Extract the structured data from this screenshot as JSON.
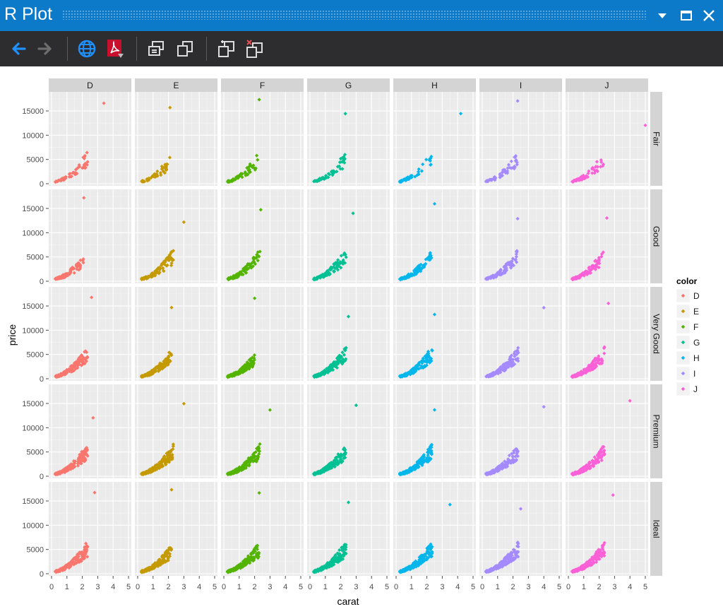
{
  "window": {
    "title": "R Plot",
    "controls": [
      "dropdown-icon",
      "maximize-icon",
      "close-icon"
    ],
    "titlebar_color": "#0c7ac9"
  },
  "toolbar": {
    "buttons": [
      "back-arrow-icon",
      "forward-arrow-icon",
      "globe-icon",
      "pdf-icon",
      "export-icon",
      "copy-icon",
      "copy-plot-icon",
      "remove-plot-icon"
    ],
    "background": "#2d2d30"
  },
  "chart_data": {
    "type": "scatter",
    "xlabel": "carat",
    "ylabel": "price",
    "xlim": [
      0,
      5
    ],
    "ylim": [
      0,
      18500
    ],
    "xticks": [
      0,
      1,
      2,
      3,
      4,
      5
    ],
    "yticks": [
      0,
      5000,
      10000,
      15000
    ],
    "ytick_labels": [
      "0",
      "5000",
      "10000",
      "15000"
    ],
    "grid": true,
    "facet_cols": [
      "D",
      "E",
      "F",
      "G",
      "H",
      "I",
      "J"
    ],
    "facet_rows": [
      "Fair",
      "Good",
      "Very Good",
      "Premium",
      "Ideal"
    ],
    "legend": {
      "title": "color",
      "position": "right",
      "entries": [
        "D",
        "E",
        "F",
        "G",
        "H",
        "I",
        "J"
      ]
    },
    "series_colors": {
      "D": "#F8766D",
      "E": "#C49A00",
      "F": "#53B400",
      "G": "#00C094",
      "H": "#00B6EB",
      "I": "#A58AFF",
      "J": "#FB61D7"
    },
    "max_carat": {
      "Fair": {
        "D": 3.4,
        "E": 2.1,
        "F": 2.3,
        "G": 2.3,
        "H": 4.2,
        "I": 2.3,
        "J": 5.0
      },
      "Good": {
        "D": 2.1,
        "E": 3.0,
        "F": 2.4,
        "G": 2.8,
        "H": 2.5,
        "I": 2.3,
        "J": 2.5
      },
      "Very Good": {
        "D": 2.6,
        "E": 2.2,
        "F": 2.0,
        "G": 2.5,
        "H": 2.5,
        "I": 4.0,
        "J": 2.6
      },
      "Premium": {
        "D": 2.7,
        "E": 3.0,
        "F": 3.0,
        "G": 3.0,
        "H": 2.5,
        "I": 4.0,
        "J": 4.0
      },
      "Ideal": {
        "D": 2.8,
        "E": 2.2,
        "F": 2.3,
        "G": 2.5,
        "H": 3.5,
        "I": 2.5,
        "J": 2.9
      }
    }
  }
}
